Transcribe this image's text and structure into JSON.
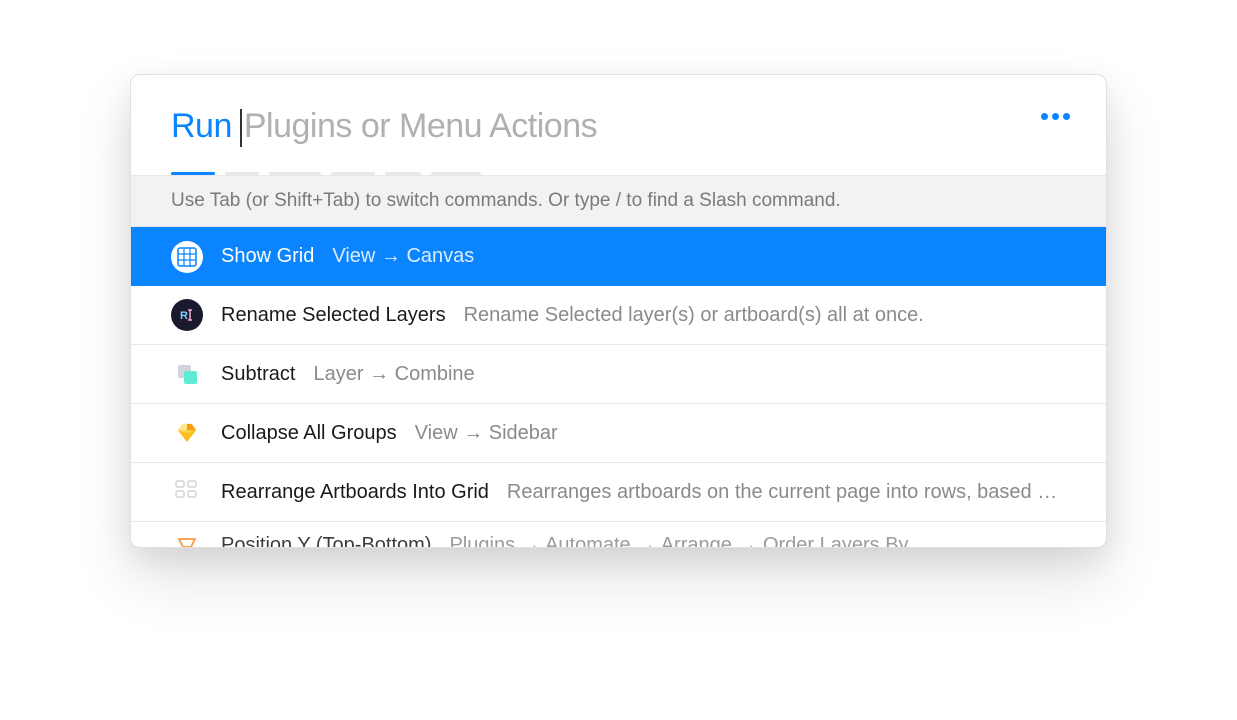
{
  "search": {
    "prefix": "Run",
    "placeholder": "Plugins or Menu Actions"
  },
  "hint": "Use Tab (or Shift+Tab) to switch commands. Or type / to find a Slash command.",
  "results": [
    {
      "icon": "grid-icon",
      "title": "Show Grid",
      "subtitle": "View → Canvas",
      "selected": true
    },
    {
      "icon": "rename-icon",
      "title": "Rename Selected Layers",
      "subtitle": "Rename Selected layer(s) or artboard(s) all at once.",
      "selected": false
    },
    {
      "icon": "subtract-icon",
      "title": "Subtract",
      "subtitle": "Layer → Combine",
      "selected": false
    },
    {
      "icon": "diamond-icon",
      "title": "Collapse All Groups",
      "subtitle": "View → Sidebar",
      "selected": false
    },
    {
      "icon": "rearrange-icon",
      "title": "Rearrange Artboards Into Grid",
      "subtitle": "Rearranges artboards on the current page into rows, based on…",
      "selected": false
    },
    {
      "icon": "position-icon",
      "title": "Position Y (Top-Bottom)",
      "subtitle": "Plugins → Automate → Arrange → Order Layers By…",
      "selected": false,
      "truncated": true
    }
  ]
}
